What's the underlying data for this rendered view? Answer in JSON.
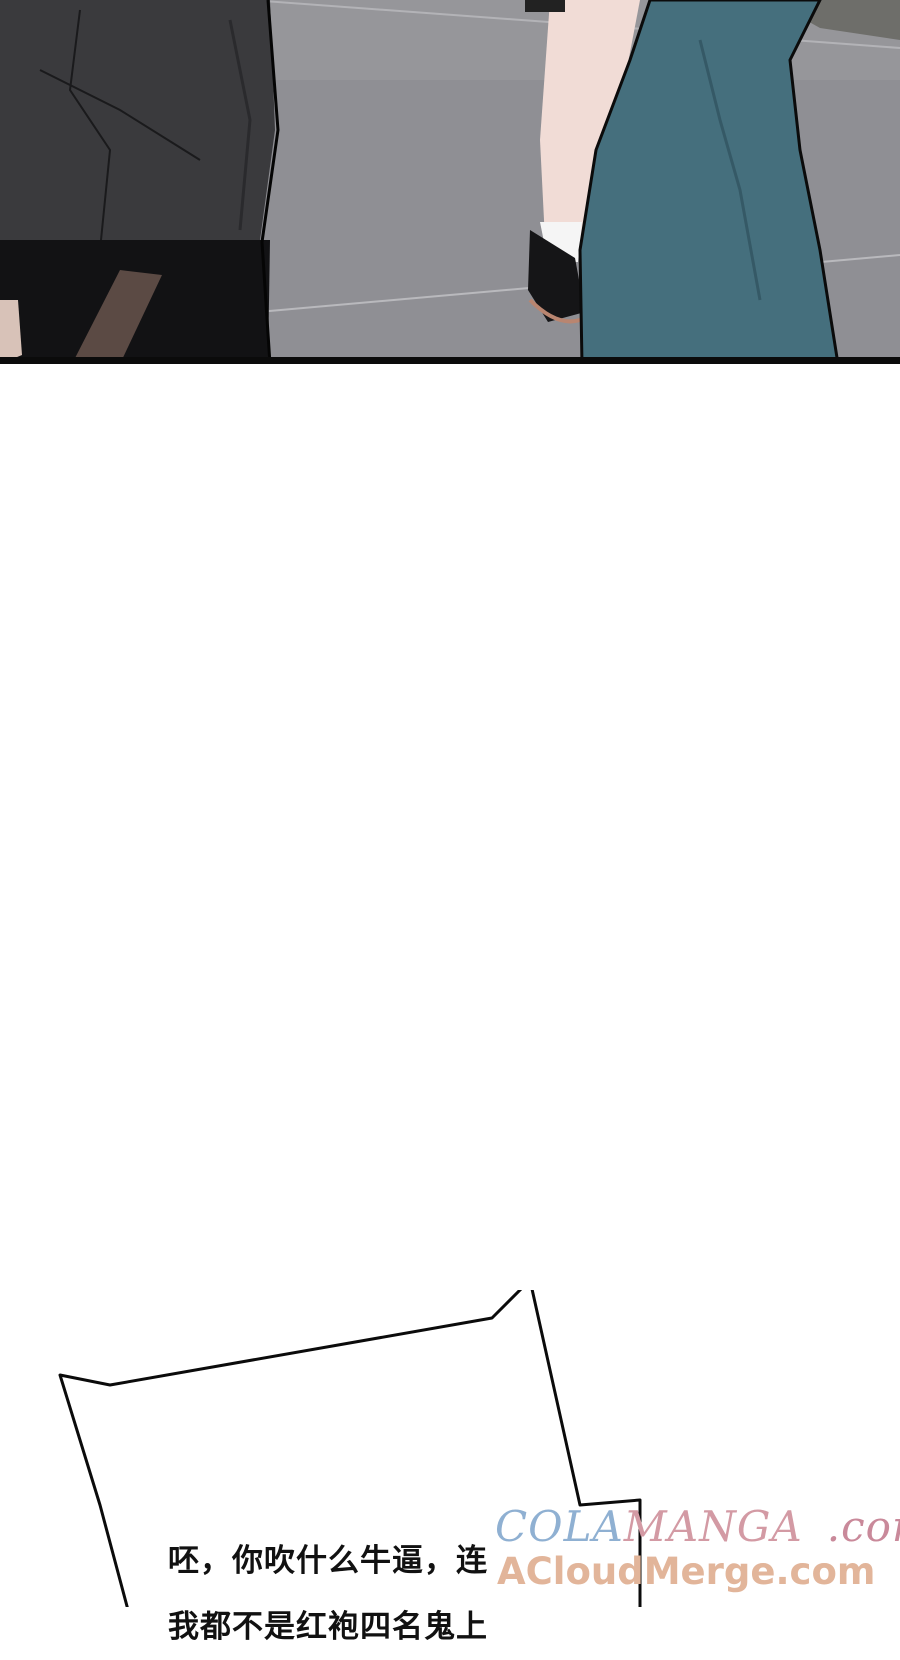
{
  "speech_bubble": {
    "lines": [
      "呸，你吹什么牛逼，连",
      "我都不是红袍四名鬼上"
    ]
  },
  "watermark": {
    "part1": "COLA",
    "part2": "MANGA",
    "part3": ".com",
    "line2": "ACloudMerge.com"
  }
}
